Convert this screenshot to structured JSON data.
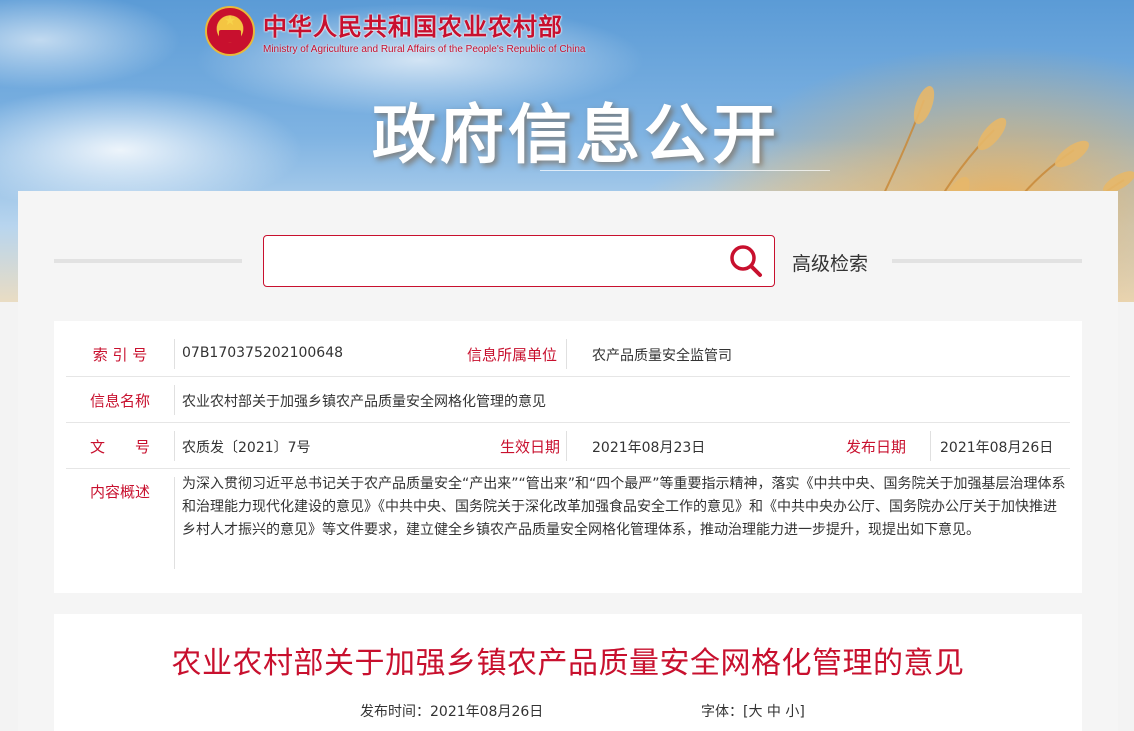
{
  "header": {
    "ministry_cn": "中华人民共和国农业农村部",
    "ministry_en": "Ministry of Agriculture and Rural Affairs of the People's Republic of China",
    "banner_title": "政府信息公开"
  },
  "search": {
    "placeholder": "",
    "value": "",
    "advanced_label": "高级检索"
  },
  "info": {
    "index_label": "索 引 号",
    "index_value": "07B170375202100648",
    "unit_label": "信息所属单位",
    "unit_value": "农产品质量安全监管司",
    "name_label": "信息名称",
    "name_value": "农业农村部关于加强乡镇农产品质量安全网格化管理的意见",
    "doc_label": "文　　号",
    "doc_value": "农质发〔2021〕7号",
    "effective_label": "生效日期",
    "effective_value": "2021年08月23日",
    "publish_label": "发布日期",
    "publish_value": "2021年08月26日",
    "summary_label": "内容概述",
    "summary_value": "为深入贯彻习近平总书记关于农产品质量安全“产出来”“管出来”和“四个最严”等重要指示精神，落实《中共中央、国务院关于加强基层治理体系和治理能力现代化建设的意见》《中共中央、国务院关于深化改革加强食品安全工作的意见》和《中共中央办公厅、国务院办公厅关于加快推进乡村人才振兴的意见》等文件要求，建立健全乡镇农产品质量安全网格化管理体系，推动治理能力进一步提升，现提出如下意见。"
  },
  "article": {
    "title": "农业农村部关于加强乡镇农产品质量安全网格化管理的意见",
    "publish_time_label": "发布时间：2021年08月26日",
    "font_label": "字体：[",
    "font_large": "大",
    "font_medium": "中",
    "font_small": "小",
    "font_close": "]"
  },
  "colors": {
    "accent": "#c8102e",
    "text": "#333333",
    "card_bg": "#ffffff"
  },
  "icons": {
    "search": "search-icon",
    "emblem": "national-emblem-icon"
  }
}
